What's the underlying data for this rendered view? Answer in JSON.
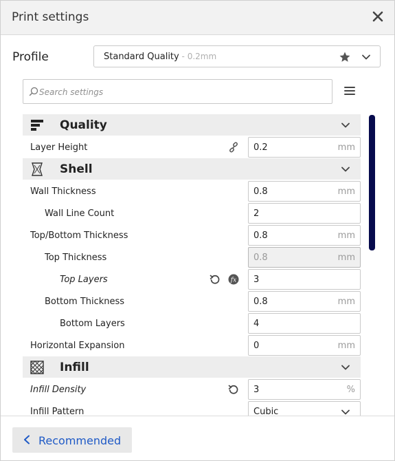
{
  "window": {
    "title": "Print settings"
  },
  "profile": {
    "label": "Profile",
    "name": "Standard Quality",
    "detail": " - 0.2mm"
  },
  "search": {
    "placeholder": "Search settings"
  },
  "categories": [
    {
      "label": "Quality"
    },
    {
      "label": "Shell"
    },
    {
      "label": "Infill"
    }
  ],
  "settings": {
    "layer_height": {
      "label": "Layer Height",
      "value": "0.2",
      "unit": "mm"
    },
    "wall_thickness": {
      "label": "Wall Thickness",
      "value": "0.8",
      "unit": "mm"
    },
    "wall_line_count": {
      "label": "Wall Line Count",
      "value": "2"
    },
    "top_bottom_thickness": {
      "label": "Top/Bottom Thickness",
      "value": "0.8",
      "unit": "mm"
    },
    "top_thickness": {
      "label": "Top Thickness",
      "value": "0.8",
      "unit": "mm"
    },
    "top_layers": {
      "label": "Top Layers",
      "value": "3"
    },
    "bottom_thickness": {
      "label": "Bottom Thickness",
      "value": "0.8",
      "unit": "mm"
    },
    "bottom_layers": {
      "label": "Bottom Layers",
      "value": "4"
    },
    "horizontal_expansion": {
      "label": "Horizontal Expansion",
      "value": "0",
      "unit": "mm"
    },
    "infill_density": {
      "label": "Infill Density",
      "value": "3",
      "unit": "%"
    },
    "infill_pattern": {
      "label": "Infill Pattern",
      "value": "Cubic"
    }
  },
  "footer": {
    "recommended_label": "Recommended"
  },
  "colors": {
    "accent": "#1f5ac6",
    "scrollbar": "#070b4d",
    "category_bg": "#ededed"
  }
}
